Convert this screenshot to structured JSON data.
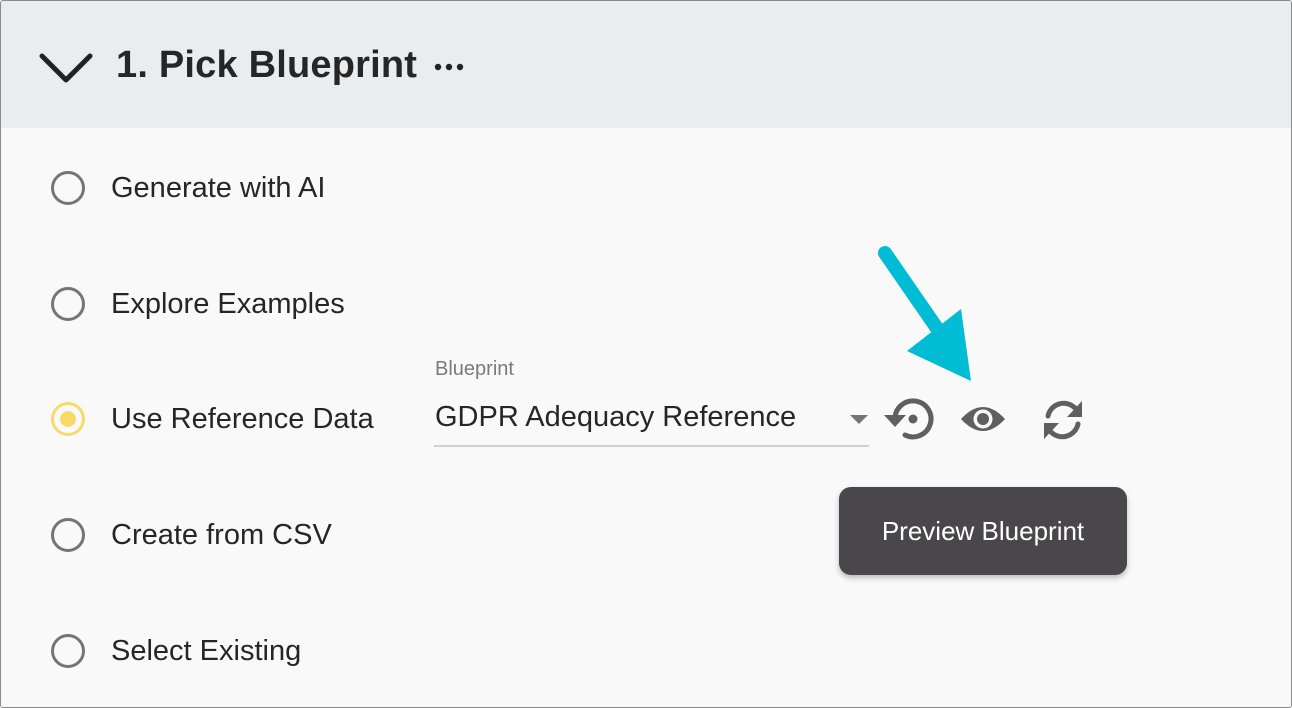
{
  "panel": {
    "title": "1. Pick Blueprint",
    "expand_icon": "chevron-down-icon",
    "more_icon": "more-horizontal-icon"
  },
  "options": [
    {
      "label": "Generate with AI",
      "selected": false
    },
    {
      "label": "Explore Examples",
      "selected": false
    },
    {
      "label": "Use Reference Data",
      "selected": true
    },
    {
      "label": "Create from CSV",
      "selected": false
    },
    {
      "label": "Select Existing",
      "selected": false
    }
  ],
  "blueprint": {
    "label": "Blueprint",
    "value": "GDPR Adequacy Reference",
    "actions": [
      "restore-icon",
      "eye-icon",
      "refresh-icon"
    ]
  },
  "tooltip": {
    "text": "Preview Blueprint"
  },
  "colors": {
    "header_bg": "#e9edf0",
    "panel_bg": "#f9f9f9",
    "radio_selected": "#f7db6a",
    "tooltip_bg": "#49474c",
    "annotation_arrow": "#00bcd4"
  }
}
